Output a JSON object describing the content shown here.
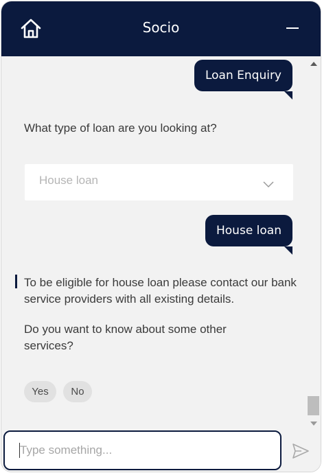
{
  "header": {
    "title": "Socio",
    "home_icon": "home-icon",
    "minimize_icon": "minimize-icon",
    "background": "#0b1a3e"
  },
  "messages": {
    "user_1": "Loan Enquiry",
    "bot_question": "What type of loan are you looking at?",
    "dropdown": {
      "selected": "House loan",
      "icon": "chevron-down-icon"
    },
    "user_2": "House loan",
    "bot_eligibility": "To be eligible for house loan please contact our bank service providers with all existing details.",
    "bot_followup": "Do you want to know about some other services?",
    "quick_replies": [
      "Yes",
      "No"
    ]
  },
  "input": {
    "placeholder": "Type something...",
    "send_icon": "send-icon"
  },
  "colors": {
    "brand": "#0b1a3e",
    "chat_background": "#f2f2f2",
    "chip_background": "#e1e1e1"
  }
}
